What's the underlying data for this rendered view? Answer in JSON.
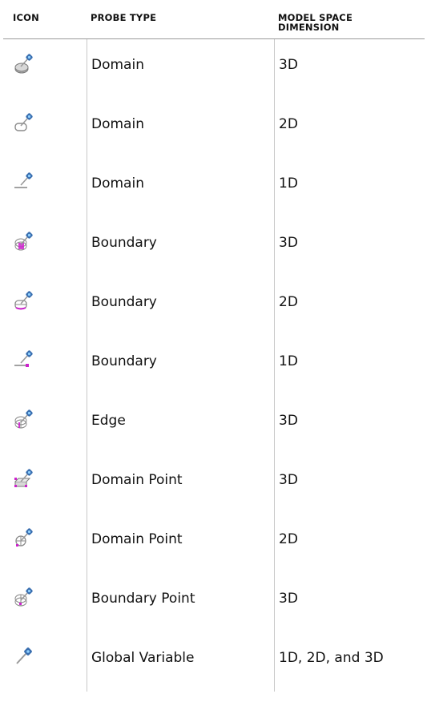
{
  "header": {
    "icon": "ICON",
    "probe_type": "PROBE TYPE",
    "dimension_line1": "MODEL SPACE",
    "dimension_line2": "DIMENSION"
  },
  "rows": [
    {
      "icon": "domain-3d-probe-icon",
      "probe_type": "Domain",
      "dimension": "3D"
    },
    {
      "icon": "domain-2d-probe-icon",
      "probe_type": "Domain",
      "dimension": "2D"
    },
    {
      "icon": "domain-1d-probe-icon",
      "probe_type": "Domain",
      "dimension": "1D"
    },
    {
      "icon": "boundary-3d-probe-icon",
      "probe_type": "Boundary",
      "dimension": "3D"
    },
    {
      "icon": "boundary-2d-probe-icon",
      "probe_type": "Boundary",
      "dimension": "2D"
    },
    {
      "icon": "boundary-1d-probe-icon",
      "probe_type": "Boundary",
      "dimension": "1D"
    },
    {
      "icon": "edge-3d-probe-icon",
      "probe_type": "Edge",
      "dimension": "3D"
    },
    {
      "icon": "domain-point-3d-probe-icon",
      "probe_type": "Domain Point",
      "dimension": "3D"
    },
    {
      "icon": "domain-point-2d-probe-icon",
      "probe_type": "Domain Point",
      "dimension": "2D"
    },
    {
      "icon": "boundary-point-3d-probe-icon",
      "probe_type": "Boundary Point",
      "dimension": "3D"
    },
    {
      "icon": "global-variable-probe-icon",
      "probe_type": "Global Variable",
      "dimension": "1D, 2D, and 3D"
    }
  ],
  "colors": {
    "probe_body": "#3a6fb0",
    "probe_tip": "#b0b0b0",
    "shape_gray": "#8a8a8a",
    "highlight": "#cc22cc"
  }
}
